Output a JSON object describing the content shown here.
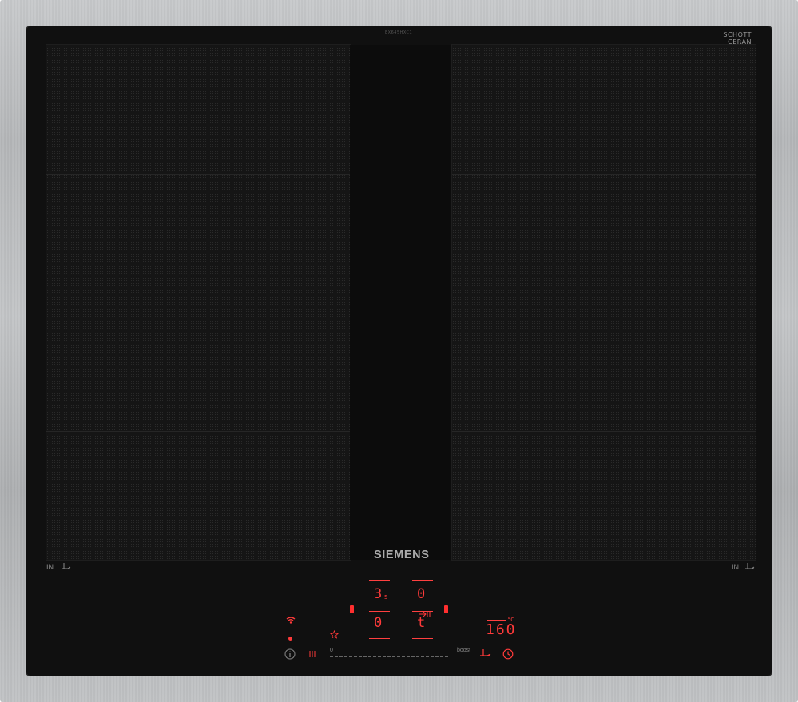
{
  "appliance": {
    "brand": "SIEMENS",
    "model_code": "EX645HXC1",
    "glass_maker": "SCHOTT",
    "glass_maker_line2": "CERAN",
    "zone_label_left": "IN",
    "zone_label_right": "IN"
  },
  "displays": {
    "front_left_level": "3",
    "front_left_fraction": "5",
    "rear_left_level": "0",
    "rear_right_level": "0",
    "front_right_level": "t",
    "timer_value": "160",
    "timer_unit": "°C"
  },
  "controls": {
    "slider_min_label": "0",
    "slider_max_label": "boost"
  },
  "colors": {
    "frame": "#bdbfc1",
    "glass": "#101010",
    "display_red": "#ff3a3a",
    "brand_text": "#a9a9a9"
  },
  "icons": [
    "wifi-icon",
    "star-icon",
    "info-icon",
    "lock-icon",
    "pan-sensor-icon",
    "clock-icon",
    "transfer-icon"
  ]
}
